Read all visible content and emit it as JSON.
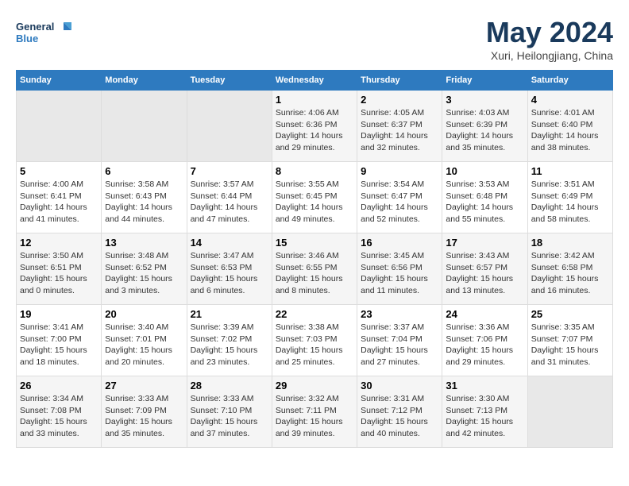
{
  "logo": {
    "line1": "General",
    "line2": "Blue"
  },
  "title": "May 2024",
  "subtitle": "Xuri, Heilongjiang, China",
  "days_of_week": [
    "Sunday",
    "Monday",
    "Tuesday",
    "Wednesday",
    "Thursday",
    "Friday",
    "Saturday"
  ],
  "weeks": [
    [
      {
        "day": "",
        "info": ""
      },
      {
        "day": "",
        "info": ""
      },
      {
        "day": "",
        "info": ""
      },
      {
        "day": "1",
        "info": "Sunrise: 4:06 AM\nSunset: 6:36 PM\nDaylight: 14 hours\nand 29 minutes."
      },
      {
        "day": "2",
        "info": "Sunrise: 4:05 AM\nSunset: 6:37 PM\nDaylight: 14 hours\nand 32 minutes."
      },
      {
        "day": "3",
        "info": "Sunrise: 4:03 AM\nSunset: 6:39 PM\nDaylight: 14 hours\nand 35 minutes."
      },
      {
        "day": "4",
        "info": "Sunrise: 4:01 AM\nSunset: 6:40 PM\nDaylight: 14 hours\nand 38 minutes."
      }
    ],
    [
      {
        "day": "5",
        "info": "Sunrise: 4:00 AM\nSunset: 6:41 PM\nDaylight: 14 hours\nand 41 minutes."
      },
      {
        "day": "6",
        "info": "Sunrise: 3:58 AM\nSunset: 6:43 PM\nDaylight: 14 hours\nand 44 minutes."
      },
      {
        "day": "7",
        "info": "Sunrise: 3:57 AM\nSunset: 6:44 PM\nDaylight: 14 hours\nand 47 minutes."
      },
      {
        "day": "8",
        "info": "Sunrise: 3:55 AM\nSunset: 6:45 PM\nDaylight: 14 hours\nand 49 minutes."
      },
      {
        "day": "9",
        "info": "Sunrise: 3:54 AM\nSunset: 6:47 PM\nDaylight: 14 hours\nand 52 minutes."
      },
      {
        "day": "10",
        "info": "Sunrise: 3:53 AM\nSunset: 6:48 PM\nDaylight: 14 hours\nand 55 minutes."
      },
      {
        "day": "11",
        "info": "Sunrise: 3:51 AM\nSunset: 6:49 PM\nDaylight: 14 hours\nand 58 minutes."
      }
    ],
    [
      {
        "day": "12",
        "info": "Sunrise: 3:50 AM\nSunset: 6:51 PM\nDaylight: 15 hours\nand 0 minutes."
      },
      {
        "day": "13",
        "info": "Sunrise: 3:48 AM\nSunset: 6:52 PM\nDaylight: 15 hours\nand 3 minutes."
      },
      {
        "day": "14",
        "info": "Sunrise: 3:47 AM\nSunset: 6:53 PM\nDaylight: 15 hours\nand 6 minutes."
      },
      {
        "day": "15",
        "info": "Sunrise: 3:46 AM\nSunset: 6:55 PM\nDaylight: 15 hours\nand 8 minutes."
      },
      {
        "day": "16",
        "info": "Sunrise: 3:45 AM\nSunset: 6:56 PM\nDaylight: 15 hours\nand 11 minutes."
      },
      {
        "day": "17",
        "info": "Sunrise: 3:43 AM\nSunset: 6:57 PM\nDaylight: 15 hours\nand 13 minutes."
      },
      {
        "day": "18",
        "info": "Sunrise: 3:42 AM\nSunset: 6:58 PM\nDaylight: 15 hours\nand 16 minutes."
      }
    ],
    [
      {
        "day": "19",
        "info": "Sunrise: 3:41 AM\nSunset: 7:00 PM\nDaylight: 15 hours\nand 18 minutes."
      },
      {
        "day": "20",
        "info": "Sunrise: 3:40 AM\nSunset: 7:01 PM\nDaylight: 15 hours\nand 20 minutes."
      },
      {
        "day": "21",
        "info": "Sunrise: 3:39 AM\nSunset: 7:02 PM\nDaylight: 15 hours\nand 23 minutes."
      },
      {
        "day": "22",
        "info": "Sunrise: 3:38 AM\nSunset: 7:03 PM\nDaylight: 15 hours\nand 25 minutes."
      },
      {
        "day": "23",
        "info": "Sunrise: 3:37 AM\nSunset: 7:04 PM\nDaylight: 15 hours\nand 27 minutes."
      },
      {
        "day": "24",
        "info": "Sunrise: 3:36 AM\nSunset: 7:06 PM\nDaylight: 15 hours\nand 29 minutes."
      },
      {
        "day": "25",
        "info": "Sunrise: 3:35 AM\nSunset: 7:07 PM\nDaylight: 15 hours\nand 31 minutes."
      }
    ],
    [
      {
        "day": "26",
        "info": "Sunrise: 3:34 AM\nSunset: 7:08 PM\nDaylight: 15 hours\nand 33 minutes."
      },
      {
        "day": "27",
        "info": "Sunrise: 3:33 AM\nSunset: 7:09 PM\nDaylight: 15 hours\nand 35 minutes."
      },
      {
        "day": "28",
        "info": "Sunrise: 3:33 AM\nSunset: 7:10 PM\nDaylight: 15 hours\nand 37 minutes."
      },
      {
        "day": "29",
        "info": "Sunrise: 3:32 AM\nSunset: 7:11 PM\nDaylight: 15 hours\nand 39 minutes."
      },
      {
        "day": "30",
        "info": "Sunrise: 3:31 AM\nSunset: 7:12 PM\nDaylight: 15 hours\nand 40 minutes."
      },
      {
        "day": "31",
        "info": "Sunrise: 3:30 AM\nSunset: 7:13 PM\nDaylight: 15 hours\nand 42 minutes."
      },
      {
        "day": "",
        "info": ""
      }
    ]
  ]
}
